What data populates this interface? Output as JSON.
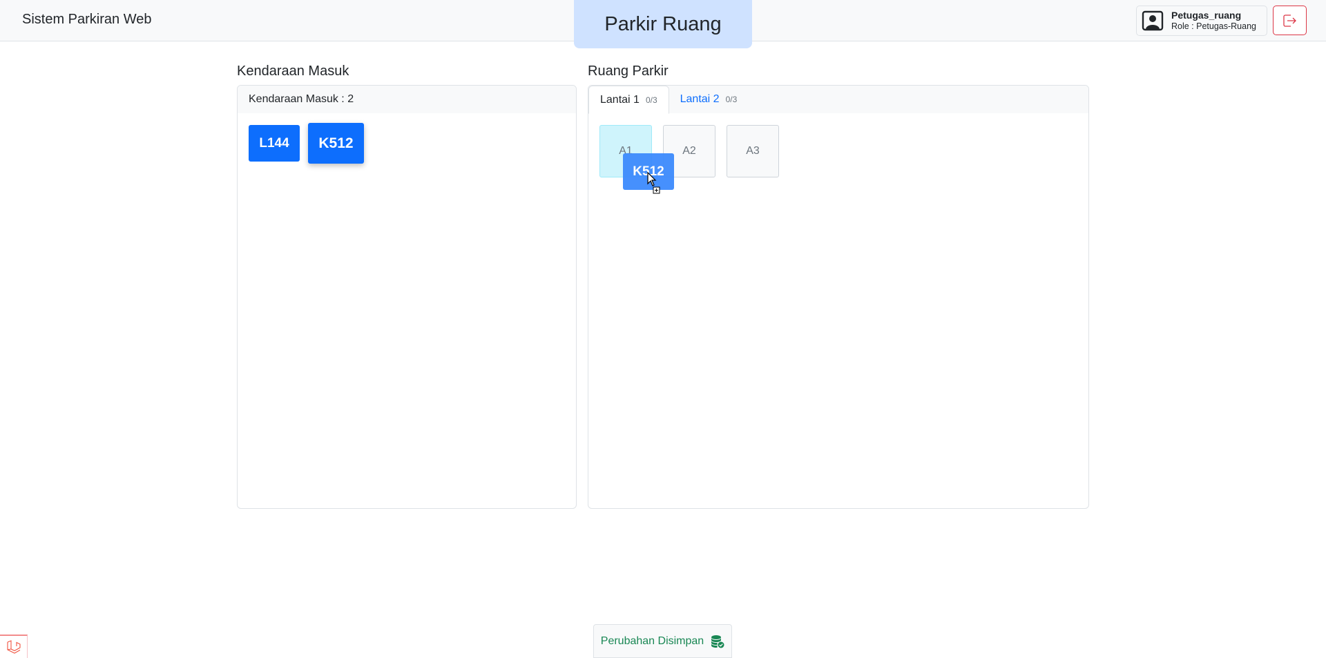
{
  "header": {
    "brand": "Sistem Parkiran Web",
    "page_title": "Parkir Ruang",
    "user": {
      "name": "Petugas_ruang",
      "role": "Role : Petugas-Ruang",
      "avatar_icon": "user-portrait-icon"
    },
    "logout_icon": "logout-icon"
  },
  "left": {
    "section_title": "Kendaraan Masuk",
    "panel_header": "Kendaraan Masuk : 2",
    "vehicles": [
      "L144",
      "K512"
    ]
  },
  "right": {
    "section_title": "Ruang Parkir",
    "tabs": [
      {
        "label": "Lantai 1",
        "count": "0/3",
        "active": true
      },
      {
        "label": "Lantai 2",
        "count": "0/3",
        "active": false
      }
    ],
    "slots": [
      "A1",
      "A2",
      "A3"
    ],
    "dragging": {
      "label": "K512",
      "over_slot": "A1"
    }
  },
  "footer": {
    "save_status": "Perubahan Disimpan",
    "save_icon": "database-check-icon"
  },
  "colors": {
    "primary": "#0d6efd",
    "success": "#198754",
    "danger": "#dc3545",
    "title_bg": "#cfe2ff",
    "slot_highlight": "#cff4fc"
  }
}
